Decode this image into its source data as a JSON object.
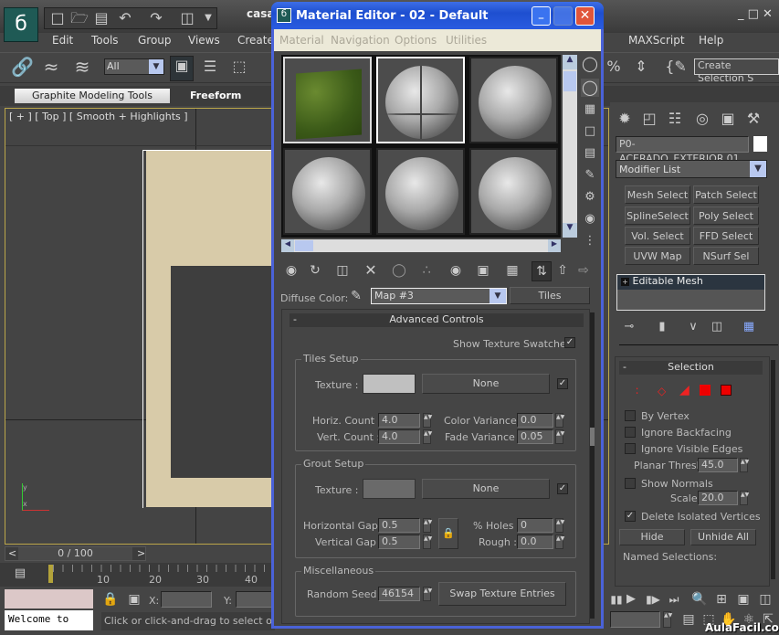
{
  "app": {
    "title": "casa",
    "menu": [
      "Edit",
      "Tools",
      "Group",
      "Views",
      "Create",
      "MAXScript",
      "Help"
    ],
    "toolbar": {
      "filter": "All",
      "named_selection": "Create Selection S"
    },
    "ribbon": {
      "tabs": [
        "Graphite Modeling Tools",
        "Freeform"
      ]
    },
    "viewport": {
      "label": "[ + ] [ Top ] [ Smooth + Highlights ]",
      "frame_color": "#d8cba9"
    },
    "timeline": {
      "position": "0 / 100",
      "ticks": [
        "0",
        "10",
        "20",
        "30",
        "40"
      ]
    },
    "status": {
      "welcome": "Welcome to",
      "x_label": "X:",
      "y_label": "Y:",
      "prompt": "Click or click-and-drag to select object"
    },
    "watermark": "AulaFacil.com"
  },
  "command_panel": {
    "object_name": "P0-ACERADO_EXTERIOR.01",
    "modifier_list": "Modifier List",
    "modifiers": [
      "Mesh Select",
      "Patch Select",
      "SplineSelect",
      "Poly Select",
      "Vol. Select",
      "FFD Select",
      "UVW Map",
      "NSurf Sel"
    ],
    "stack": [
      "Editable Mesh"
    ],
    "selection": {
      "title": "Selection",
      "by_vertex": "By Vertex",
      "ignore_backfacing": "Ignore Backfacing",
      "ignore_visible_edges": "Ignore Visible Edges",
      "planar_thresh_label": "Planar Thresh:",
      "planar_thresh": "45.0",
      "show_normals": "Show Normals",
      "scale_label": "Scale:",
      "scale": "20.0",
      "delete_isolated": "Delete Isolated Vertices",
      "delete_isolated_checked": true,
      "hide": "Hide",
      "unhide_all": "Unhide All",
      "named_selections": "Named Selections:"
    }
  },
  "material_editor": {
    "title": "Material Editor - 02 - Default",
    "menu": [
      "Material",
      "Navigation",
      "Options",
      "Utilities"
    ],
    "diffuse_label": "Diffuse Color:",
    "map_name": "Map #3",
    "map_type": "Tiles",
    "rollout": "Advanced Controls",
    "show_swatches": "Show Texture Swatches",
    "tiles": {
      "title": "Tiles Setup",
      "texture_label": "Texture :",
      "texture_map": "None",
      "texture_color": "#c0c0c0",
      "horiz_label": "Horiz. Count :",
      "horiz": "4.0",
      "vert_label": "Vert. Count :",
      "vert": "4.0",
      "color_var_label": "Color Variance :",
      "color_var": "0.0",
      "fade_var_label": "Fade Variance :",
      "fade_var": "0.05"
    },
    "grout": {
      "title": "Grout Setup",
      "texture_label": "Texture :",
      "texture_map": "None",
      "texture_color": "#6a6a6a",
      "hgap_label": "Horizontal Gap :",
      "hgap": "0.5",
      "vgap_label": "Vertical Gap :",
      "vgap": "0.5",
      "holes_label": "% Holes :",
      "holes": "0",
      "rough_label": "Rough :",
      "rough": "0.0"
    },
    "misc": {
      "title": "Miscellaneous",
      "seed_label": "Random Seed :",
      "seed": "46154",
      "swap": "Swap Texture Entries"
    }
  }
}
